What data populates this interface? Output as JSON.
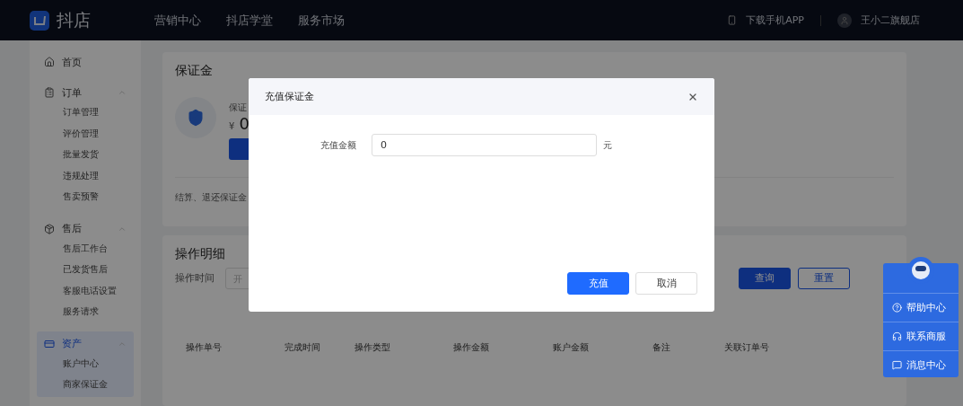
{
  "header": {
    "logo_text": "抖店",
    "nav": [
      {
        "label": "营销中心"
      },
      {
        "label": "抖店学堂"
      },
      {
        "label": "服务市场"
      }
    ],
    "download": "下载手机APP",
    "user": "王小二旗舰店"
  },
  "sidebar": {
    "items": [
      {
        "kind": "link",
        "label": "首页",
        "selected": false
      },
      {
        "kind": "group",
        "label": "订单",
        "selected": false,
        "expanded": true,
        "children": [
          {
            "label": "订单管理",
            "selected": false
          },
          {
            "label": "评价管理",
            "selected": false
          },
          {
            "label": "批量发货",
            "selected": false
          },
          {
            "label": "违规处理",
            "selected": false
          },
          {
            "label": "售卖预警",
            "selected": false
          }
        ]
      },
      {
        "kind": "group",
        "label": "售后",
        "selected": false,
        "expanded": true,
        "children": [
          {
            "label": "售后工作台",
            "selected": false
          },
          {
            "label": "已发货售后",
            "selected": false
          },
          {
            "label": "客服电话设置",
            "selected": false
          },
          {
            "label": "服务请求",
            "selected": false
          }
        ]
      },
      {
        "kind": "group",
        "label": "资产",
        "selected": true,
        "expanded": true,
        "children": [
          {
            "label": "账户中心",
            "selected": false
          },
          {
            "label": "商家保证金",
            "selected": false
          }
        ]
      }
    ]
  },
  "deposit_card": {
    "title": "保证金",
    "label": "保证",
    "currency": "¥",
    "amount": "0",
    "note": "结算、退还保证金"
  },
  "details_card": {
    "title": "操作明细",
    "filter_label": "操作时间",
    "date_placeholder": "开",
    "buttons": [
      {
        "label": "查询",
        "kind": "primary"
      },
      {
        "label": "重置",
        "kind": "outline"
      }
    ],
    "columns": [
      "操作单号",
      "完成时间",
      "操作类型",
      "操作金额",
      "账户金额",
      "备注",
      "关联订单号"
    ]
  },
  "help_widget": {
    "items": [
      {
        "label": "帮助中心"
      },
      {
        "label": "联系商服"
      },
      {
        "label": "消息中心"
      }
    ]
  },
  "modal": {
    "title": "充值保证金",
    "field_label": "充值金额",
    "value": "0",
    "unit": "元",
    "buttons": [
      {
        "label": "充值",
        "kind": "primary"
      },
      {
        "label": "取消",
        "kind": "default"
      }
    ]
  }
}
